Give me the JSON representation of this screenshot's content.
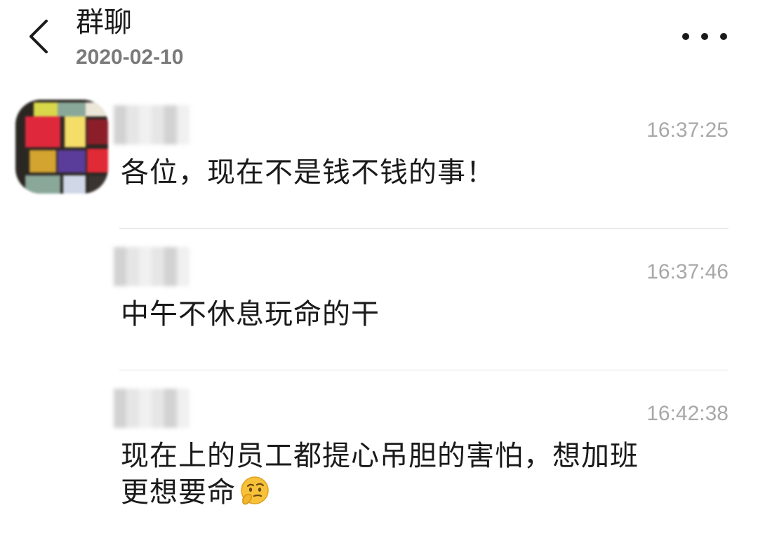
{
  "header": {
    "title": "群聊",
    "date": "2020-02-10"
  },
  "messages": [
    {
      "time": "16:37:25",
      "text": "各位，现在不是钱不钱的事！"
    },
    {
      "time": "16:37:46",
      "text": "中午不休息玩命的干"
    },
    {
      "time": "16:42:38",
      "text_line1": "现在上的员工都提心吊胆的害怕，想加班",
      "text_line2": "更想要命",
      "emoji": "thinking-face-emoji"
    }
  ],
  "icons": {
    "back": "chevron-left-icon",
    "more": "more-dots-icon"
  },
  "colors": {
    "text": "#1a1a1a",
    "secondary": "#7a7a7a",
    "time": "#a8a8a8",
    "divider": "#e3e3e3"
  }
}
